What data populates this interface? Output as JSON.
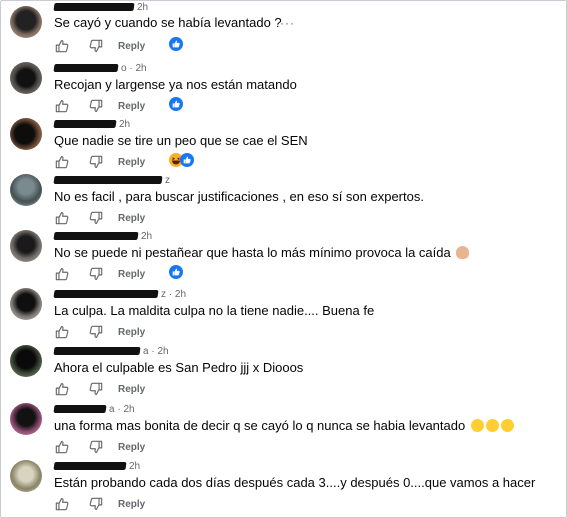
{
  "reply_label": "Reply",
  "more_options": "···",
  "colors": {
    "like_blue": "#1877f2",
    "meta_gray": "#65676b",
    "text": "#050505"
  },
  "comments": [
    {
      "name_tail": "",
      "time": "2h",
      "text": "Se cayó y cuando se había levantado ?",
      "reaction": "like"
    },
    {
      "name_tail": "o",
      "time": "2h",
      "text": "Recojan y largense ya nos están matando",
      "reaction": "like"
    },
    {
      "name_tail": "",
      "time": "2h",
      "text": "Que nadie se tire un peo que se cae el SEN",
      "reaction": "haha-like"
    },
    {
      "name_tail": "z",
      "time": "2h",
      "text": "No es facil , para buscar justificaciones , en eso sí son expertos.",
      "reaction": "none"
    },
    {
      "name_tail": "",
      "time": "2h",
      "text": "No se puede ni pestañear que hasta lo más mínimo provoca la caída",
      "reaction": "like"
    },
    {
      "name_tail": "z",
      "time": "2h",
      "text": "La culpa. La maldita culpa no la tiene nadie.... Buena fe",
      "reaction": "none"
    },
    {
      "name_tail": "a",
      "time": "2h",
      "text": "Ahora el culpable es San Pedro jjj x Diooos",
      "reaction": "none"
    },
    {
      "name_tail": "a",
      "time": "2h",
      "text": "una forma mas bonita de decir q se cayó lo q nunca se habia levantado",
      "reaction": "none"
    },
    {
      "name_tail": "",
      "time": "2h",
      "text": "Están probando cada dos días después cada 3....y después 0....que vamos a hacer",
      "reaction": "none"
    }
  ]
}
